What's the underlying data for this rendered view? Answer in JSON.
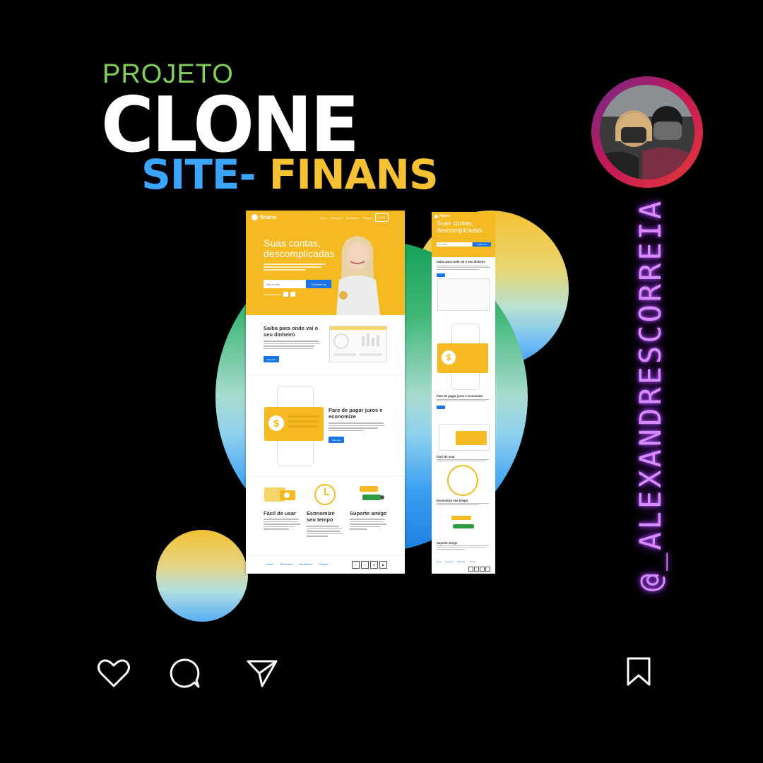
{
  "headline": {
    "projeto": "PROJETO",
    "clone": "CLONE",
    "site": "SITE-",
    "finans": " FINANS"
  },
  "handle": "@_ALEXANDRESCORREIA",
  "colors": {
    "background": "#000000",
    "projeto_green": "#7fcf5a",
    "site_blue": "#3aa4ff",
    "finans_yellow": "#f6c233",
    "brand_yellow": "#f5b921",
    "brand_blue": "#1a73e8",
    "neon_purple": "#d88bff"
  },
  "desktop_mockup": {
    "logo": "finans",
    "nav": [
      "Home",
      "Recursos",
      "Benefícios",
      "Preços"
    ],
    "nav_button": "Entrar",
    "hero_title": "Suas contas, descomplicadas",
    "email_placeholder": "Seu e-mail",
    "signup_button": "Cadastre-se",
    "store_label": "Disponível para:",
    "section1_title": "Saiba para onde vai o seu dinheiro",
    "section1_button": "Veja mais",
    "section2_title": "Pare de pagar juros e economize",
    "section2_button": "Veja mais",
    "features": [
      {
        "title": "Fácil de usar"
      },
      {
        "title": "Economize seu tempo"
      },
      {
        "title": "Suporte amigo"
      }
    ],
    "footer_nav": [
      "Home",
      "Recursos",
      "Benefícios",
      "Preços"
    ]
  },
  "mobile_mockup": {
    "logo": "finans",
    "hero_title": "Suas contas, descomplicadas",
    "email_placeholder": "Seu e-mail",
    "signup_button": "Cadastre-se",
    "section1_title": "Saiba para onde vai o seu dinheiro",
    "section2_title": "Pare de pagar juros e economize",
    "feature1": "Fácil de usar",
    "feature2": "Economize seu tempo",
    "feature3": "Suporte amigo",
    "footer_nav": [
      "Home",
      "Recursos",
      "Benefícios",
      "Preços"
    ]
  },
  "icons": {
    "like": "heart-icon",
    "comment": "comment-icon",
    "share": "send-icon",
    "save": "bookmark-icon"
  }
}
